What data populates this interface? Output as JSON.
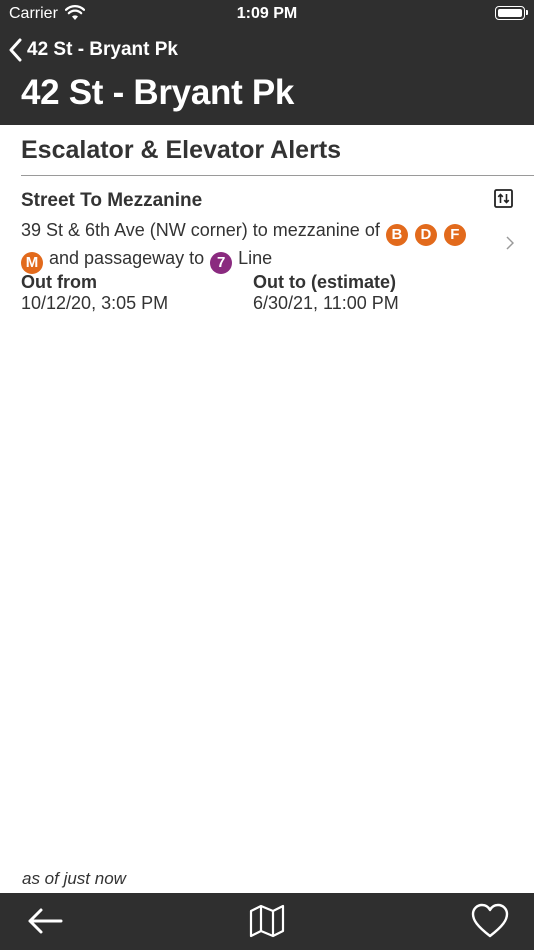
{
  "status_bar": {
    "carrier": "Carrier",
    "time": "1:09 PM"
  },
  "nav": {
    "back_label": "42 St - Bryant Pk",
    "title": "42 St - Bryant Pk"
  },
  "section": {
    "title": "Escalator & Elevator Alerts"
  },
  "alert": {
    "title": "Street To Mezzanine",
    "equipment_icon": "escalator-icon",
    "desc_part1": "39 St & 6th Ave (NW corner) to mezzanine of",
    "desc_part2": "and passageway to",
    "desc_part3": "Line",
    "bullets_primary": [
      {
        "label": "B",
        "color": "#e26a1c"
      },
      {
        "label": "D",
        "color": "#e26a1c"
      },
      {
        "label": "F",
        "color": "#e26a1c"
      },
      {
        "label": "M",
        "color": "#e26a1c"
      }
    ],
    "bullet_secondary": {
      "label": "7",
      "color": "#8a2a7f"
    },
    "out_from_label": "Out from",
    "out_from_value": "10/12/20, 3:05 PM",
    "out_to_label": "Out to (estimate)",
    "out_to_value": "6/30/21, 11:00 PM"
  },
  "footer": {
    "as_of": "as of just now"
  },
  "toolbar": {
    "icons": [
      "arrow-left-icon",
      "map-icon",
      "heart-icon"
    ]
  },
  "colors": {
    "bar_background": "#2f2f2f",
    "orange_line": "#e26a1c",
    "purple_line": "#8a2a7f"
  }
}
